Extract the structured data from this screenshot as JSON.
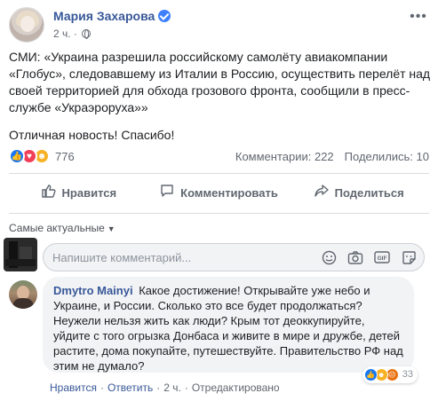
{
  "post": {
    "author": "Мария Захарова",
    "time": "2 ч.",
    "paragraphs": [
      "СМИ: «Украина разрешила российскому самолёту авиакомпании «Глобус», следовавшему из Италии в Россию, осуществить перелёт над своей территорией для обхода грозового фронта, сообщили в пресс-службе «Украэроруха»»",
      "Отличная новость! Спасибо!"
    ],
    "reactions_count": "776",
    "comments": "Комментарии: 222",
    "shares": "Поделились: 10"
  },
  "actions": {
    "like": "Нравится",
    "comment": "Комментировать",
    "share": "Поделиться"
  },
  "comments_section": {
    "sort_label": "Самые актуальные",
    "input_placeholder": "Напишите комментарий..."
  },
  "comment": {
    "author": "Dmytro Mainyi",
    "text": "Какое достижение! Открывайте уже небо и Украине, и России. Сколько это все будет продолжаться? Неужели нельзя жить как люди? Крым тот деоккупируйте, уйдите с того огрызка Донбаса и живите в мире и дружбе, детей растите, дома покупайте, путешествуйте. Правительство РФ над этим не думало?",
    "reactions_count": "33",
    "like": "Нравится",
    "reply": "Ответить",
    "time": "2 ч.",
    "edited": "Отредактировано"
  },
  "colors": {
    "link_blue": "#385898",
    "like_blue": "#1877f2",
    "love_red": "#f33e58",
    "haha_yellow": "#f7b125",
    "angry_orange": "#e9710f",
    "bubble_gray": "#f2f3f5"
  },
  "icons": [
    "verified-badge-icon",
    "globe-icon",
    "more-options-icon",
    "like-icon",
    "comment-icon",
    "share-icon",
    "emoji-icon",
    "camera-icon",
    "gif-icon",
    "sticker-icon"
  ]
}
